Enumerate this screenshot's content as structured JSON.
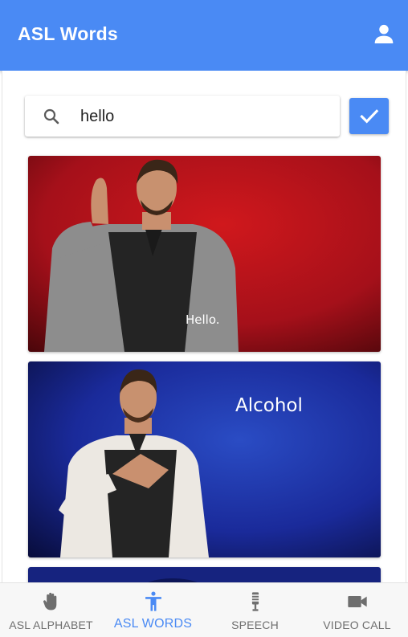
{
  "app": {
    "title": "ASL Words"
  },
  "search": {
    "value": "hello",
    "placeholder": ""
  },
  "results": [
    {
      "caption": "Hello."
    },
    {
      "caption": "Alcohol"
    }
  ],
  "nav": [
    {
      "label": "ASL ALPHABET",
      "icon": "hand-icon"
    },
    {
      "label": "ASL WORDS",
      "icon": "accessibility-icon",
      "active": true
    },
    {
      "label": "SPEECH",
      "icon": "microphone-icon"
    },
    {
      "label": "VIDEO CALL",
      "icon": "videocam-icon"
    }
  ],
  "colors": {
    "primary": "#4a8af4",
    "inactive": "#6e6e6e",
    "card1_bg": "#b41418",
    "card2_bg": "#1a2a9a"
  }
}
